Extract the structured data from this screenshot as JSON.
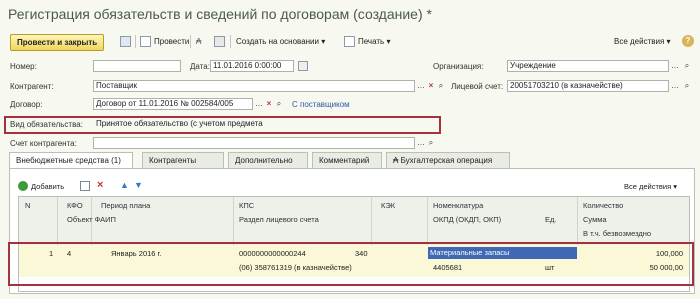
{
  "window": {
    "title": "Регистрация обязательств и сведений по договорам (создание) *"
  },
  "toolbar": {
    "post_close": "Провести и закрыть",
    "post": "Провести",
    "create_based": "Создать на основании",
    "print": "Печать",
    "all_actions": "Все действия",
    "help": "?"
  },
  "form": {
    "number_label": "Номер:",
    "number_value": "",
    "date_label": "Дата:",
    "date_value": "11.01.2016  0:00:00",
    "org_label": "Организация:",
    "org_value": "Учреждение",
    "contractor_label": "Контрагент:",
    "contractor_value": "Поставщик",
    "account_label": "Лицевой счет:",
    "account_value": "20051703210 (в казначействе)",
    "contract_label": "Договор:",
    "contract_value": "Договор от 11.01.2016 № 002584/005",
    "contract_link": "С поставщиком",
    "obligation_type_label": "Вид обязательства:",
    "obligation_type_value": "Принятое обязательство (с учетом предмета",
    "contractor_account_label": "Счет контрагента:",
    "contractor_account_value": ""
  },
  "tabs": [
    "Внебюджетные средства (1)",
    "Контрагенты",
    "Дополнительно",
    "Комментарий",
    "Бухгалтерская операция"
  ],
  "table_toolbar": {
    "add": "Добавить",
    "all_actions": "Все действия"
  },
  "table": {
    "headers": {
      "n": "N",
      "kfo": "КФО",
      "period": "Период плана",
      "object": "Объект ФАИП",
      "kps": "КПС",
      "account_section": "Раздел лицевого счета",
      "kek": "КЭК",
      "nomenclature": "Номенклатура",
      "okdp": "ОКПД (ОКДП, ОКП)",
      "unit": "Ед.",
      "quantity": "Количество",
      "sum": "Сумма",
      "free": "В т.ч. безвозмездно"
    },
    "rows": [
      {
        "n": "1",
        "kfo": "4",
        "period": "Январь 2016 г.",
        "kps": "0000000000000244",
        "account_section": "(06) 358761319 (в казначействе)",
        "kek": "340",
        "nomenclature": "Материальные запасы",
        "okdp": "4405681",
        "unit": "шт",
        "quantity": "100,000",
        "sum": "50 000,00"
      }
    ]
  }
}
